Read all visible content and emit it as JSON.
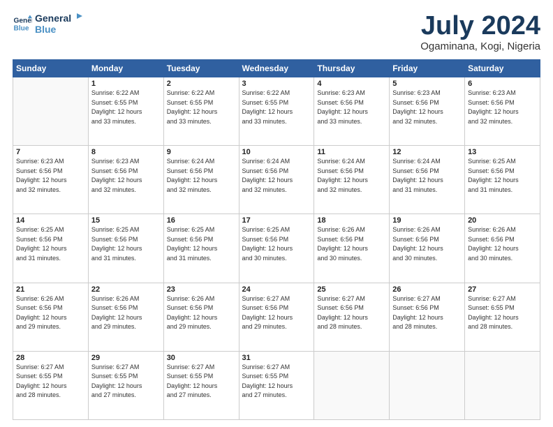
{
  "logo": {
    "line1": "General",
    "line2": "Blue",
    "icon_color": "#4a90c4"
  },
  "title": "July 2024",
  "subtitle": "Ogaminana, Kogi, Nigeria",
  "days_header": [
    "Sunday",
    "Monday",
    "Tuesday",
    "Wednesday",
    "Thursday",
    "Friday",
    "Saturday"
  ],
  "weeks": [
    [
      {
        "num": "",
        "info": ""
      },
      {
        "num": "1",
        "info": "Sunrise: 6:22 AM\nSunset: 6:55 PM\nDaylight: 12 hours\nand 33 minutes."
      },
      {
        "num": "2",
        "info": "Sunrise: 6:22 AM\nSunset: 6:55 PM\nDaylight: 12 hours\nand 33 minutes."
      },
      {
        "num": "3",
        "info": "Sunrise: 6:22 AM\nSunset: 6:55 PM\nDaylight: 12 hours\nand 33 minutes."
      },
      {
        "num": "4",
        "info": "Sunrise: 6:23 AM\nSunset: 6:56 PM\nDaylight: 12 hours\nand 33 minutes."
      },
      {
        "num": "5",
        "info": "Sunrise: 6:23 AM\nSunset: 6:56 PM\nDaylight: 12 hours\nand 32 minutes."
      },
      {
        "num": "6",
        "info": "Sunrise: 6:23 AM\nSunset: 6:56 PM\nDaylight: 12 hours\nand 32 minutes."
      }
    ],
    [
      {
        "num": "7",
        "info": "Sunrise: 6:23 AM\nSunset: 6:56 PM\nDaylight: 12 hours\nand 32 minutes."
      },
      {
        "num": "8",
        "info": "Sunrise: 6:23 AM\nSunset: 6:56 PM\nDaylight: 12 hours\nand 32 minutes."
      },
      {
        "num": "9",
        "info": "Sunrise: 6:24 AM\nSunset: 6:56 PM\nDaylight: 12 hours\nand 32 minutes."
      },
      {
        "num": "10",
        "info": "Sunrise: 6:24 AM\nSunset: 6:56 PM\nDaylight: 12 hours\nand 32 minutes."
      },
      {
        "num": "11",
        "info": "Sunrise: 6:24 AM\nSunset: 6:56 PM\nDaylight: 12 hours\nand 32 minutes."
      },
      {
        "num": "12",
        "info": "Sunrise: 6:24 AM\nSunset: 6:56 PM\nDaylight: 12 hours\nand 31 minutes."
      },
      {
        "num": "13",
        "info": "Sunrise: 6:25 AM\nSunset: 6:56 PM\nDaylight: 12 hours\nand 31 minutes."
      }
    ],
    [
      {
        "num": "14",
        "info": "Sunrise: 6:25 AM\nSunset: 6:56 PM\nDaylight: 12 hours\nand 31 minutes."
      },
      {
        "num": "15",
        "info": "Sunrise: 6:25 AM\nSunset: 6:56 PM\nDaylight: 12 hours\nand 31 minutes."
      },
      {
        "num": "16",
        "info": "Sunrise: 6:25 AM\nSunset: 6:56 PM\nDaylight: 12 hours\nand 31 minutes."
      },
      {
        "num": "17",
        "info": "Sunrise: 6:25 AM\nSunset: 6:56 PM\nDaylight: 12 hours\nand 30 minutes."
      },
      {
        "num": "18",
        "info": "Sunrise: 6:26 AM\nSunset: 6:56 PM\nDaylight: 12 hours\nand 30 minutes."
      },
      {
        "num": "19",
        "info": "Sunrise: 6:26 AM\nSunset: 6:56 PM\nDaylight: 12 hours\nand 30 minutes."
      },
      {
        "num": "20",
        "info": "Sunrise: 6:26 AM\nSunset: 6:56 PM\nDaylight: 12 hours\nand 30 minutes."
      }
    ],
    [
      {
        "num": "21",
        "info": "Sunrise: 6:26 AM\nSunset: 6:56 PM\nDaylight: 12 hours\nand 29 minutes."
      },
      {
        "num": "22",
        "info": "Sunrise: 6:26 AM\nSunset: 6:56 PM\nDaylight: 12 hours\nand 29 minutes."
      },
      {
        "num": "23",
        "info": "Sunrise: 6:26 AM\nSunset: 6:56 PM\nDaylight: 12 hours\nand 29 minutes."
      },
      {
        "num": "24",
        "info": "Sunrise: 6:27 AM\nSunset: 6:56 PM\nDaylight: 12 hours\nand 29 minutes."
      },
      {
        "num": "25",
        "info": "Sunrise: 6:27 AM\nSunset: 6:56 PM\nDaylight: 12 hours\nand 28 minutes."
      },
      {
        "num": "26",
        "info": "Sunrise: 6:27 AM\nSunset: 6:56 PM\nDaylight: 12 hours\nand 28 minutes."
      },
      {
        "num": "27",
        "info": "Sunrise: 6:27 AM\nSunset: 6:55 PM\nDaylight: 12 hours\nand 28 minutes."
      }
    ],
    [
      {
        "num": "28",
        "info": "Sunrise: 6:27 AM\nSunset: 6:55 PM\nDaylight: 12 hours\nand 28 minutes."
      },
      {
        "num": "29",
        "info": "Sunrise: 6:27 AM\nSunset: 6:55 PM\nDaylight: 12 hours\nand 27 minutes."
      },
      {
        "num": "30",
        "info": "Sunrise: 6:27 AM\nSunset: 6:55 PM\nDaylight: 12 hours\nand 27 minutes."
      },
      {
        "num": "31",
        "info": "Sunrise: 6:27 AM\nSunset: 6:55 PM\nDaylight: 12 hours\nand 27 minutes."
      },
      {
        "num": "",
        "info": ""
      },
      {
        "num": "",
        "info": ""
      },
      {
        "num": "",
        "info": ""
      }
    ]
  ]
}
